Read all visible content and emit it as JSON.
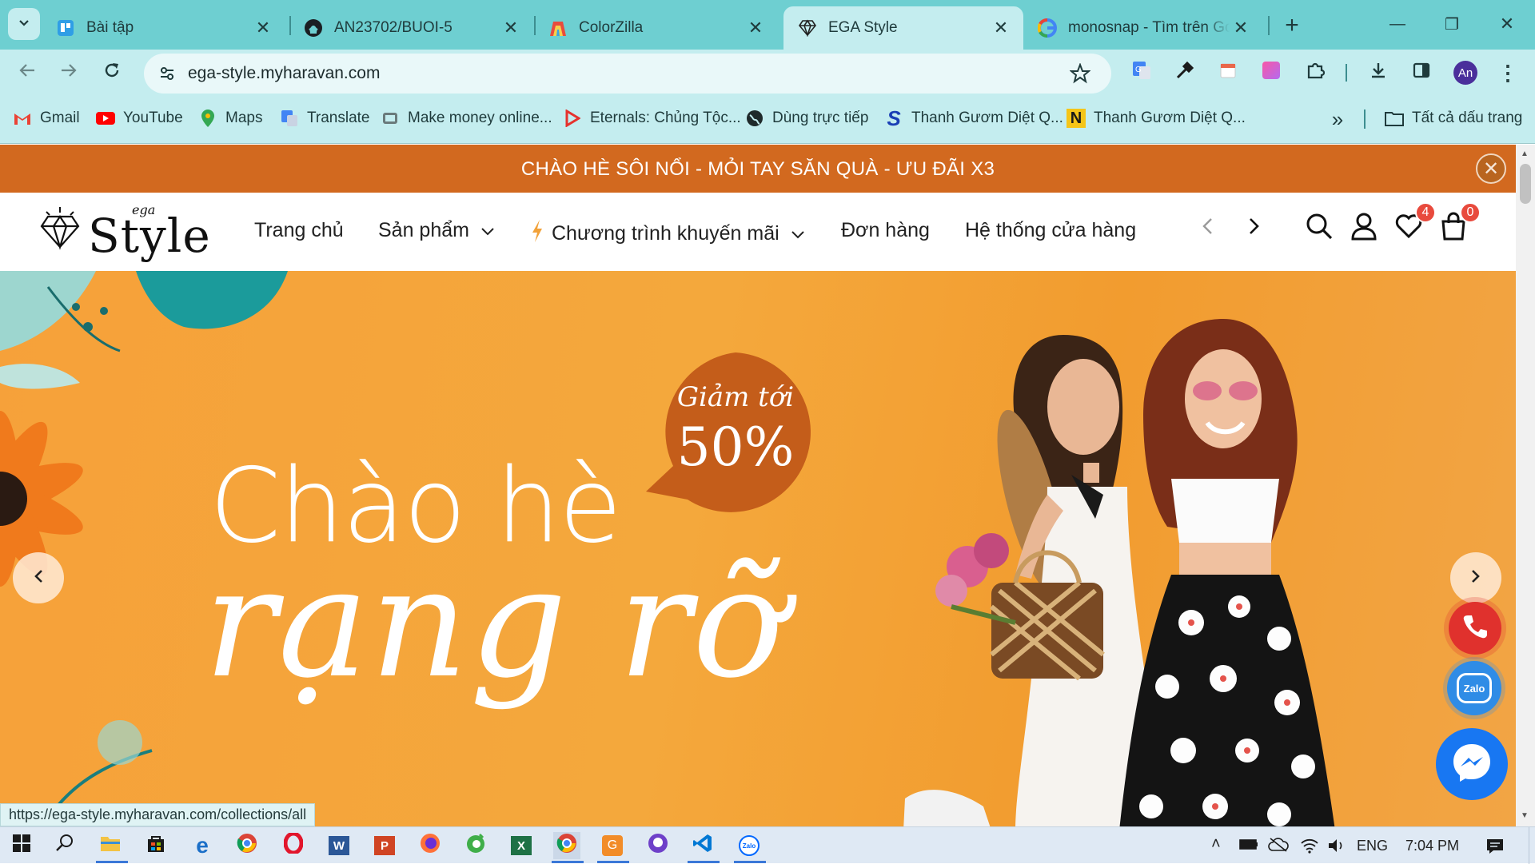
{
  "browser": {
    "tabs": [
      {
        "title": "Bài tập",
        "icon": "trello-icon",
        "active": false
      },
      {
        "title": "AN23702/BUOI-5",
        "icon": "github-icon",
        "active": false
      },
      {
        "title": "ColorZilla",
        "icon": "colorzilla-icon",
        "active": false
      },
      {
        "title": "EGA Style",
        "icon": "diamond-icon",
        "active": true
      },
      {
        "title": "monosnap - Tìm trên Google",
        "icon": "google-icon",
        "active": false
      }
    ],
    "new_tab": "+",
    "window_controls": {
      "minimize": "—",
      "restore": "❐",
      "close": "✕"
    },
    "url": "ega-style.myharavan.com",
    "profile_initials": "An",
    "bookmarks": [
      {
        "label": "Gmail",
        "icon": "gmail-icon"
      },
      {
        "label": "YouTube",
        "icon": "youtube-icon"
      },
      {
        "label": "Maps",
        "icon": "maps-icon"
      },
      {
        "label": "Translate",
        "icon": "translate-icon"
      },
      {
        "label": "Make money online...",
        "icon": "bookmark-site-icon"
      },
      {
        "label": "Eternals: Chủng Tộc...",
        "icon": "play-icon"
      },
      {
        "label": "Dùng trực tiếp",
        "icon": "globe-icon"
      },
      {
        "label": "Thanh Gươm Diệt Q...",
        "icon": "s-logo-icon"
      },
      {
        "label": "Thanh Gươm Diệt Q...",
        "icon": "n-logo-icon"
      }
    ],
    "more_bookmarks": "»",
    "all_bookmarks": "Tất cả dấu trang",
    "status_url": "https://ega-style.myharavan.com/collections/all"
  },
  "site": {
    "promo_bar": "CHÀO HÈ SÔI NỔI - MỎI TAY SĂN QUÀ - ƯU ĐÃI X3",
    "logo": {
      "small": "ega",
      "main": "Style"
    },
    "nav": [
      "Trang chủ",
      "Sản phẩm",
      "Chương trình khuyến mãi",
      "Đơn hàng",
      "Hệ thống cửa hàng"
    ],
    "wishlist_count": "4",
    "cart_count": "0",
    "banner": {
      "headline_1": "Chào hè",
      "headline_2": "rạng rỡ",
      "discount_line_1": "Giảm tới",
      "discount_line_2": "50%"
    },
    "zalo_label": "Zalo"
  },
  "taskbar": {
    "language": "ENG",
    "time": "7:04 PM"
  },
  "colors": {
    "tab_strip": "#6ecfd1",
    "toolbar": "#c4edef",
    "promo_bar": "#d2691f",
    "banner": "#f4a23a",
    "discount_badge": "#c45d1a",
    "phone_button": "#e0312d",
    "zalo_button": "#2f8ce6",
    "messenger_button": "#1877f2"
  }
}
